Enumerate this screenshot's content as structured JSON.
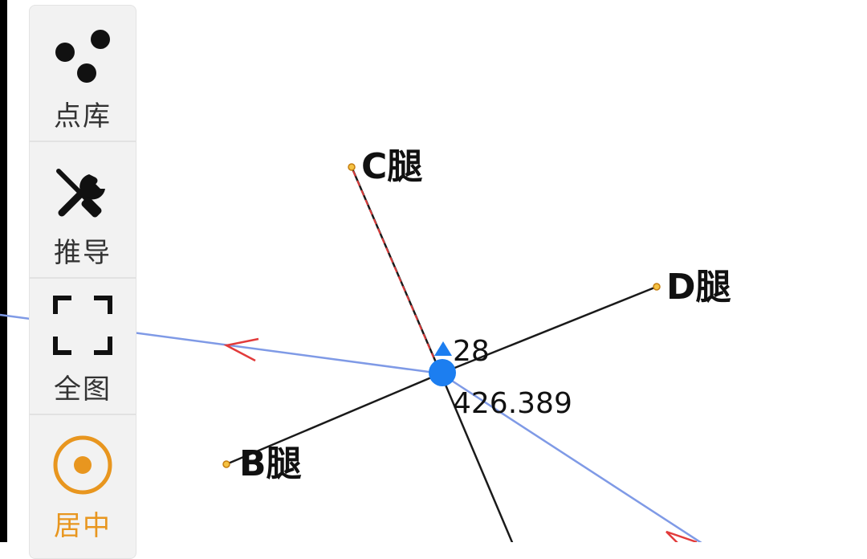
{
  "colors": {
    "accent": "#e8961f",
    "ray_blue": "#7f9ae6",
    "marker_blue": "#1c7ef0",
    "leg_line": "#1a1a1a",
    "leg_dash": "#e23b3b"
  },
  "toolbar": {
    "items": [
      {
        "label": "点库",
        "icon": "point-library-icon",
        "active": false
      },
      {
        "label": "推导",
        "icon": "tools-icon",
        "active": false
      },
      {
        "label": "全图",
        "icon": "fullscreen-icon",
        "active": false
      },
      {
        "label": "居中",
        "icon": "center-target-icon",
        "active": true
      }
    ]
  },
  "map": {
    "legs": [
      {
        "label": "C腿"
      },
      {
        "label": "D腿"
      },
      {
        "label": "B腿"
      }
    ],
    "station": {
      "angle_value": "28",
      "distance_value": "426.389"
    }
  }
}
